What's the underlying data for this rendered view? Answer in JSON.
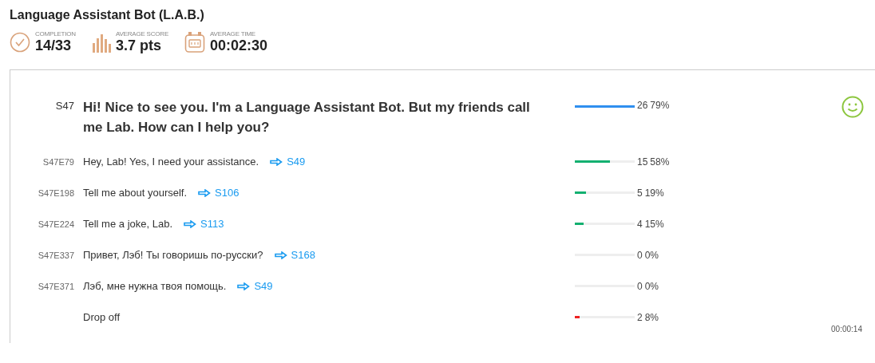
{
  "title": "Language Assistant Bot (L.A.B.)",
  "stats": [
    {
      "kind": "check",
      "label": "COMPLETION",
      "value": "14/33"
    },
    {
      "kind": "bars",
      "label": "AVERAGE SCORE",
      "value": "3.7 pts"
    },
    {
      "kind": "clock",
      "label": "AVERAGE TIME",
      "value": "00:02:30"
    }
  ],
  "rows": [
    {
      "kind": "question",
      "id": "S47",
      "text": "Hi! Nice to see you. I'm a Language Assistant Bot. But my friends call me Lab. How can I help you?",
      "count": "26",
      "percent": "79%",
      "level": 1,
      "color": "#2f8fef"
    },
    {
      "kind": "answer",
      "id": "S47E79",
      "text": "Hey, Lab! Yes, I need your assistance.",
      "link": "S49",
      "count": "15",
      "percent": "58%",
      "level": 0.58,
      "color": "#13b070"
    },
    {
      "kind": "answer",
      "id": "S47E198",
      "text": "Tell me about yourself.",
      "link": "S106",
      "count": "5",
      "percent": "19%",
      "level": 0.19,
      "color": "#13b070"
    },
    {
      "kind": "answer",
      "id": "S47E224",
      "text": "Tell me a joke, Lab.",
      "link": "S113",
      "count": "4",
      "percent": "15%",
      "level": 0.15,
      "color": "#13b070"
    },
    {
      "kind": "answer",
      "id": "S47E337",
      "text": "Привет, Лэб! Ты говоришь по-русски?",
      "link": "S168",
      "count": "0",
      "percent": "0%",
      "level": 0
    },
    {
      "kind": "answer",
      "id": "S47E371",
      "text": "Лэб, мне нужна твоя помощь.",
      "link": "S49",
      "count": "0",
      "percent": "0%",
      "level": 0
    },
    {
      "kind": "dropoff",
      "text": "Drop off",
      "count": "2",
      "percent": "8%",
      "level": 0.08,
      "color": "#ee2222"
    }
  ],
  "time": "00:00:14"
}
